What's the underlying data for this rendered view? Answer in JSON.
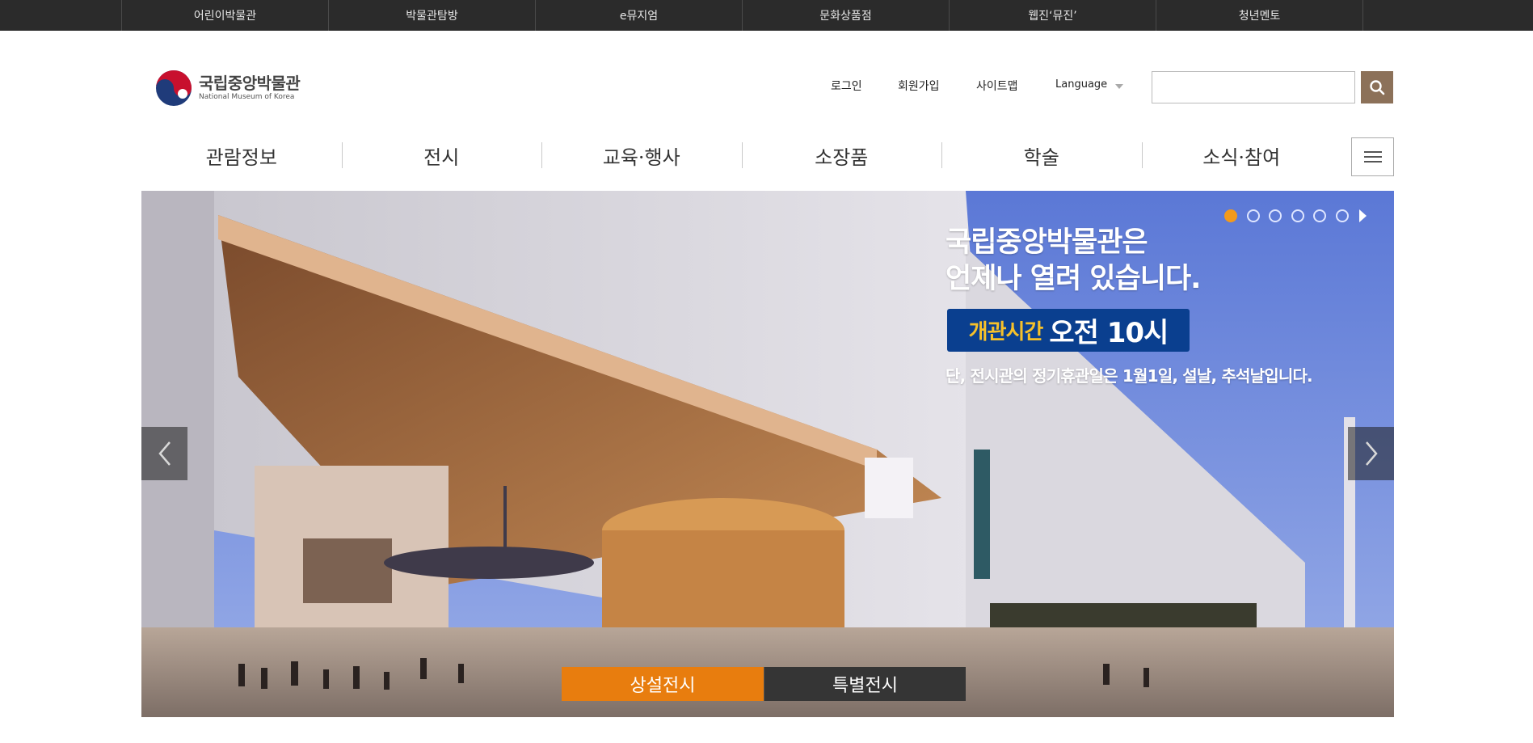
{
  "topbar": {
    "links": [
      "어린이박물관",
      "박물관탐방",
      "e뮤지엄",
      "문화상품점",
      "웹진‘뮤진’",
      "청년멘토"
    ]
  },
  "header": {
    "logo_ko": "국립중앙박물관",
    "logo_en": "National Museum of Korea",
    "util": {
      "login": "로그인",
      "join": "회원가입",
      "sitemap": "사이트맵",
      "language": "Language"
    },
    "search": {
      "placeholder": "",
      "value": ""
    }
  },
  "nav": {
    "items": [
      "관람정보",
      "전시",
      "교육·행사",
      "소장품",
      "학술",
      "소식·참여"
    ],
    "menu_icon": "hamburger-icon"
  },
  "hero": {
    "title_line1": "국립중앙박물관은",
    "title_line2": "언제나 열려 있습니다.",
    "hours_label": "개관시간",
    "hours_time": "오전 10시",
    "note": "단, 전시관의 정기휴관일은 1월1일, 설날, 추석날입니다.",
    "slide_count": 6,
    "active_slide": 1,
    "tabs": [
      {
        "label": "상설전시",
        "active": true
      },
      {
        "label": "특별전시",
        "active": false
      }
    ]
  },
  "colors": {
    "topbar_bg": "#2b2b2b",
    "search_button": "#8c7159",
    "active_dot": "#f39a1a",
    "active_tab": "#e87d0e",
    "inactive_tab": "#353535",
    "hours_box": "#0a3f8f",
    "hours_label": "#f6c12a"
  }
}
